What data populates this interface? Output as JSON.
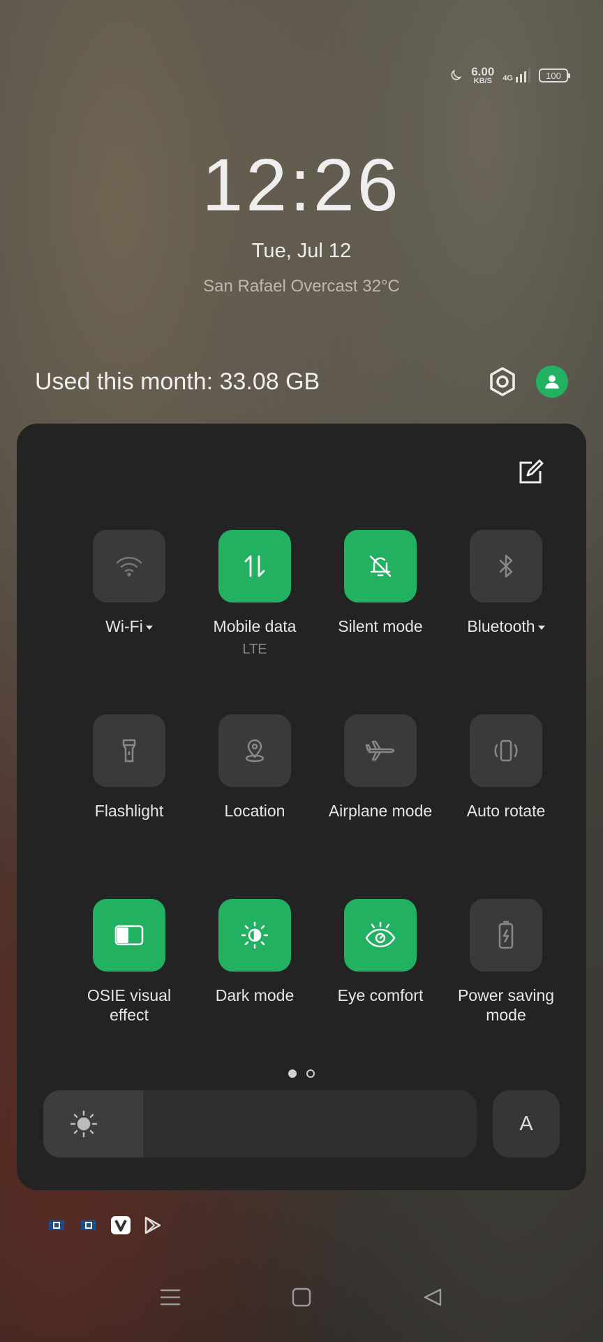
{
  "status_bar": {
    "net_speed_value": "6.00",
    "net_speed_unit": "KB/S",
    "network_type": "4G",
    "battery": "100"
  },
  "lockscreen": {
    "time": "12:26",
    "date": "Tue, Jul 12",
    "weather": "San Rafael Overcast 32°C"
  },
  "header": {
    "data_usage": "Used this month: 33.08 GB"
  },
  "tiles": [
    {
      "label": "Wi-Fi",
      "sub": "",
      "on": false,
      "icon": "wifi-icon"
    },
    {
      "label": "Mobile data",
      "sub": "LTE",
      "on": true,
      "icon": "mobile-data-icon"
    },
    {
      "label": "Silent mode",
      "sub": "",
      "on": true,
      "icon": "bell-off-icon"
    },
    {
      "label": "Bluetooth",
      "sub": "",
      "on": false,
      "icon": "bluetooth-icon"
    },
    {
      "label": "Flashlight",
      "sub": "",
      "on": false,
      "icon": "flashlight-icon"
    },
    {
      "label": "Location",
      "sub": "",
      "on": false,
      "icon": "location-icon"
    },
    {
      "label": "Airplane mode",
      "sub": "",
      "on": false,
      "icon": "airplane-icon"
    },
    {
      "label": "Auto rotate",
      "sub": "",
      "on": false,
      "icon": "auto-rotate-icon"
    },
    {
      "label": "OSIE visual effect",
      "sub": "",
      "on": true,
      "icon": "osie-icon"
    },
    {
      "label": "Dark mode",
      "sub": "",
      "on": true,
      "icon": "dark-mode-icon"
    },
    {
      "label": "Eye comfort",
      "sub": "",
      "on": true,
      "icon": "eye-icon"
    },
    {
      "label": "Power saving mode",
      "sub": "",
      "on": false,
      "icon": "battery-saver-icon"
    }
  ],
  "pagination": {
    "current": 1,
    "total": 2
  },
  "brightness": {
    "level": 0.23,
    "auto_label": "A"
  },
  "colors": {
    "accent": "#22b061",
    "panel": "#232323",
    "tile_off": "#3a3a3a"
  }
}
